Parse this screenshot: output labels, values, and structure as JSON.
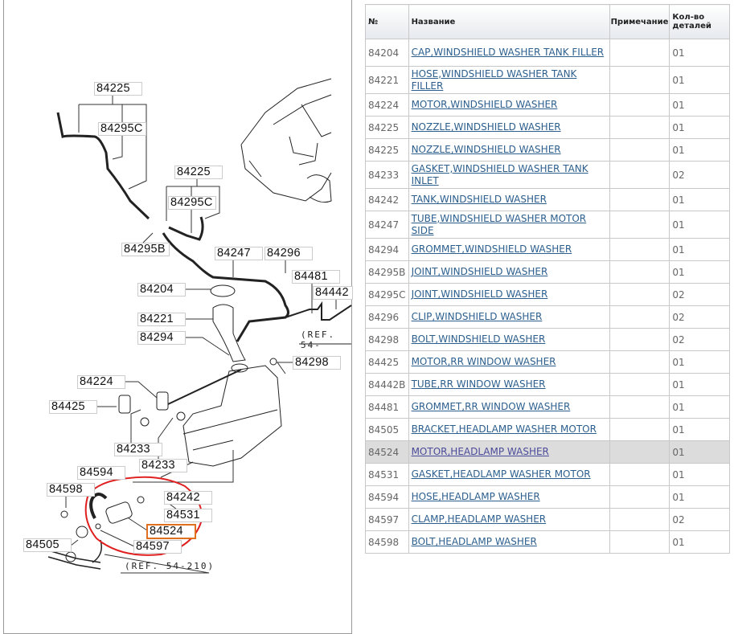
{
  "diagram": {
    "labels": [
      "84225",
      "84295C",
      "84225",
      "84295C",
      "84295B",
      "84247",
      "84296",
      "84481",
      "84442",
      "84204",
      "84221",
      "84294",
      "84298",
      "84224",
      "84425",
      "84233",
      "84233",
      "84594",
      "84598",
      "84242",
      "84531",
      "84524",
      "84505",
      "84597"
    ],
    "ref_top": "(REF. 54-",
    "ref_bottom": "(REF. 54-210)",
    "selected_label": "84524",
    "highlight_colors": {
      "circle": "#e02020",
      "selected_box": "#e07020"
    }
  },
  "table": {
    "headers": {
      "num": "№",
      "name": "Название",
      "note": "Примечание",
      "qty": "Кол-во деталей"
    },
    "selected_row": "84524",
    "rows": [
      {
        "num": "84204",
        "name": "CAP,WINDSHIELD WASHER TANK FILLER",
        "note": "",
        "qty": "01"
      },
      {
        "num": "84221",
        "name": "HOSE,WINDSHIELD WASHER TANK FILLER",
        "note": "",
        "qty": "01"
      },
      {
        "num": "84224",
        "name": "MOTOR,WINDSHIELD WASHER",
        "note": "",
        "qty": "01"
      },
      {
        "num": "84225",
        "name": "NOZZLE,WINDSHIELD WASHER",
        "note": "",
        "qty": "01"
      },
      {
        "num": "84225",
        "name": "NOZZLE,WINDSHIELD WASHER",
        "note": "",
        "qty": "01"
      },
      {
        "num": "84233",
        "name": "GASKET,WINDSHIELD WASHER TANK INLET",
        "note": "",
        "qty": "02"
      },
      {
        "num": "84242",
        "name": "TANK,WINDSHIELD WASHER",
        "note": "",
        "qty": "01"
      },
      {
        "num": "84247",
        "name": "TUBE,WINDSHIELD WASHER MOTOR SIDE",
        "note": "",
        "qty": "01"
      },
      {
        "num": "84294",
        "name": "GROMMET,WINDSHIELD WASHER",
        "note": "",
        "qty": "01"
      },
      {
        "num": "84295B",
        "name": "JOINT,WINDSHIELD WASHER",
        "note": "",
        "qty": "01"
      },
      {
        "num": "84295C",
        "name": "JOINT,WINDSHIELD WASHER",
        "note": "",
        "qty": "02"
      },
      {
        "num": "84296",
        "name": "CLIP,WINDSHIELD WASHER",
        "note": "",
        "qty": "02"
      },
      {
        "num": "84298",
        "name": "BOLT,WINDSHIELD WASHER",
        "note": "",
        "qty": "02"
      },
      {
        "num": "84425",
        "name": "MOTOR,RR WINDOW WASHER",
        "note": "",
        "qty": "01"
      },
      {
        "num": "84442B",
        "name": "TUBE,RR WINDOW WASHER",
        "note": "",
        "qty": "01"
      },
      {
        "num": "84481",
        "name": "GROMMET,RR WINDOW WASHER",
        "note": "",
        "qty": "01"
      },
      {
        "num": "84505",
        "name": "BRACKET,HEADLAMP WASHER MOTOR",
        "note": "",
        "qty": "01"
      },
      {
        "num": "84524",
        "name": "MOTOR,HEADLAMP WASHER",
        "note": "",
        "qty": "01"
      },
      {
        "num": "84531",
        "name": "GASKET,HEADLAMP WASHER MOTOR",
        "note": "",
        "qty": "01"
      },
      {
        "num": "84594",
        "name": "HOSE,HEADLAMP WASHER",
        "note": "",
        "qty": "01"
      },
      {
        "num": "84597",
        "name": "CLAMP,HEADLAMP WASHER",
        "note": "",
        "qty": "02"
      },
      {
        "num": "84598",
        "name": "BOLT,HEADLAMP WASHER",
        "note": "",
        "qty": "01"
      }
    ]
  }
}
